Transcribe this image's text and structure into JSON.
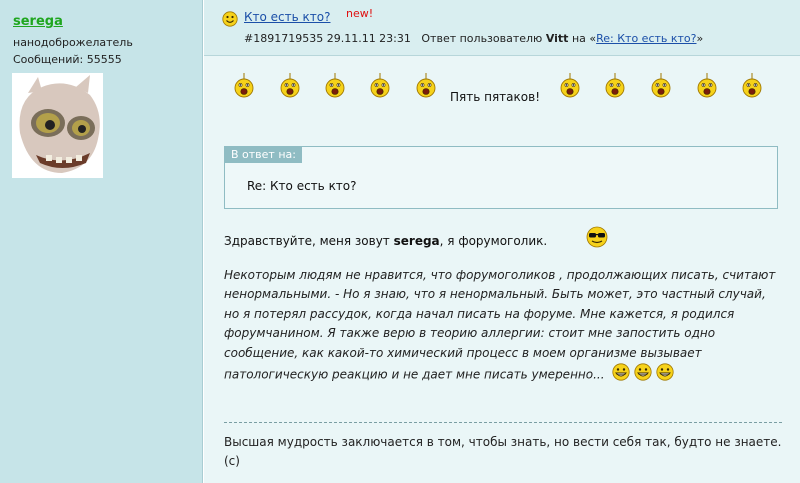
{
  "author": {
    "nick": "serega",
    "rank": "нанодоброжелатель",
    "posts_label": "Сообщений: 55555"
  },
  "header": {
    "title": "Кто есть кто?",
    "new_tag": "new!",
    "post_id": "#1891719535",
    "date": "29.11.11 23:31",
    "reply_prefix": "Ответ пользователю",
    "reply_user": "Vitt",
    "reply_on": "на «",
    "reply_link": "Re: Кто есть кто?",
    "reply_end": "»"
  },
  "signature": {
    "text": "Пять пятаков!",
    "smiley_icon": "shocked-smiley-icon"
  },
  "quote": {
    "label": "В ответ на:",
    "text": "Re: Кто есть кто?"
  },
  "greeting": {
    "before": "Здравствуйте, меня зовут ",
    "name": "serega",
    "after": ", я форумоголик."
  },
  "paragraph": "Некоторым людям не нравится, что форумоголиков , продолжающих писать, считают ненормальными. - Но я знаю, что я ненормальный. Быть может, это частный случай, но я потерял рассудок, когда начал писать на форуме. Мне кажется, я родился форумчанином. Я также верю в теорию аллергии: стоит мне запостить одно сообщение, как какой-то химический процесс в моем организме вызывает патологическую реакцию и не дает мне писать умеренно...",
  "footer_quote": "Высшая мудрость заключается в том, чтобы знать, но вести себя так, будто не знаете. (c)",
  "colors": {
    "sidebar": "#c6e4e8",
    "header": "#d9eef0",
    "content": "#eaf6f7",
    "link": "#1b4fa8",
    "nick": "#1fa61f",
    "new": "#e01010"
  }
}
